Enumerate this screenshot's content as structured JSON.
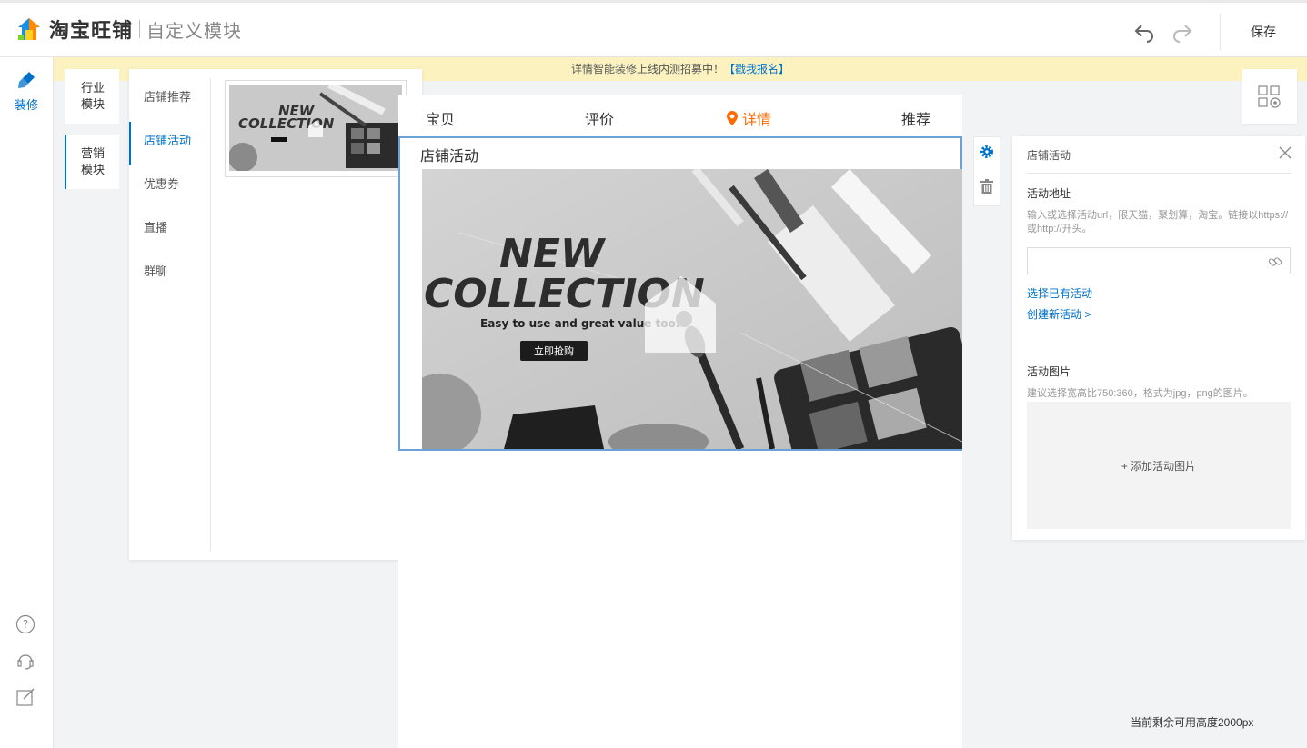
{
  "header": {
    "brand": "淘宝旺铺",
    "subtitle": "自定义模块",
    "save_label": "保存"
  },
  "left_rail": {
    "decor_label": "装修"
  },
  "notice": {
    "text": "详情智能装修上线内测招募中！",
    "link": "【戳我报名】",
    "bg_color": "#fbf2c0"
  },
  "module_tabs": [
    {
      "label": "行业模块",
      "active": false
    },
    {
      "label": "营销模块",
      "active": true
    }
  ],
  "sub_nav": [
    {
      "label": "店铺推荐",
      "active": false
    },
    {
      "label": "店铺活动",
      "active": true
    },
    {
      "label": "优惠券",
      "active": false
    },
    {
      "label": "直播",
      "active": false
    },
    {
      "label": "群聊",
      "active": false
    }
  ],
  "canvas": {
    "nav": [
      {
        "label": "宝贝",
        "active": false
      },
      {
        "label": "评价",
        "active": false
      },
      {
        "label": "详情",
        "active": true
      },
      {
        "label": "推荐",
        "active": false
      }
    ],
    "module_title": "店铺活动",
    "banner": {
      "headline_1": "NEW",
      "headline_2": "COLLECTION",
      "tagline": "Easy to use and great value too.",
      "cta": "立即抢购"
    },
    "remaining_height": "当前剩余可用高度2000px"
  },
  "panel": {
    "title": "店铺活动",
    "address_label": "活动地址",
    "address_hint": "输入或选择活动url，限天猫，聚划算，淘宝。链接以https://或http://开头。",
    "address_value": "",
    "select_existing": "选择已有活动",
    "create_new": "创建新活动 >",
    "image_label": "活动图片",
    "image_hint": "建议选择宽高比750:360，格式为jpg，png的图片。",
    "add_image": "+ 添加活动图片"
  },
  "colors": {
    "accent": "#0071c9",
    "active_orange": "#ff6a00",
    "frame_blue": "#6aa1d6"
  }
}
